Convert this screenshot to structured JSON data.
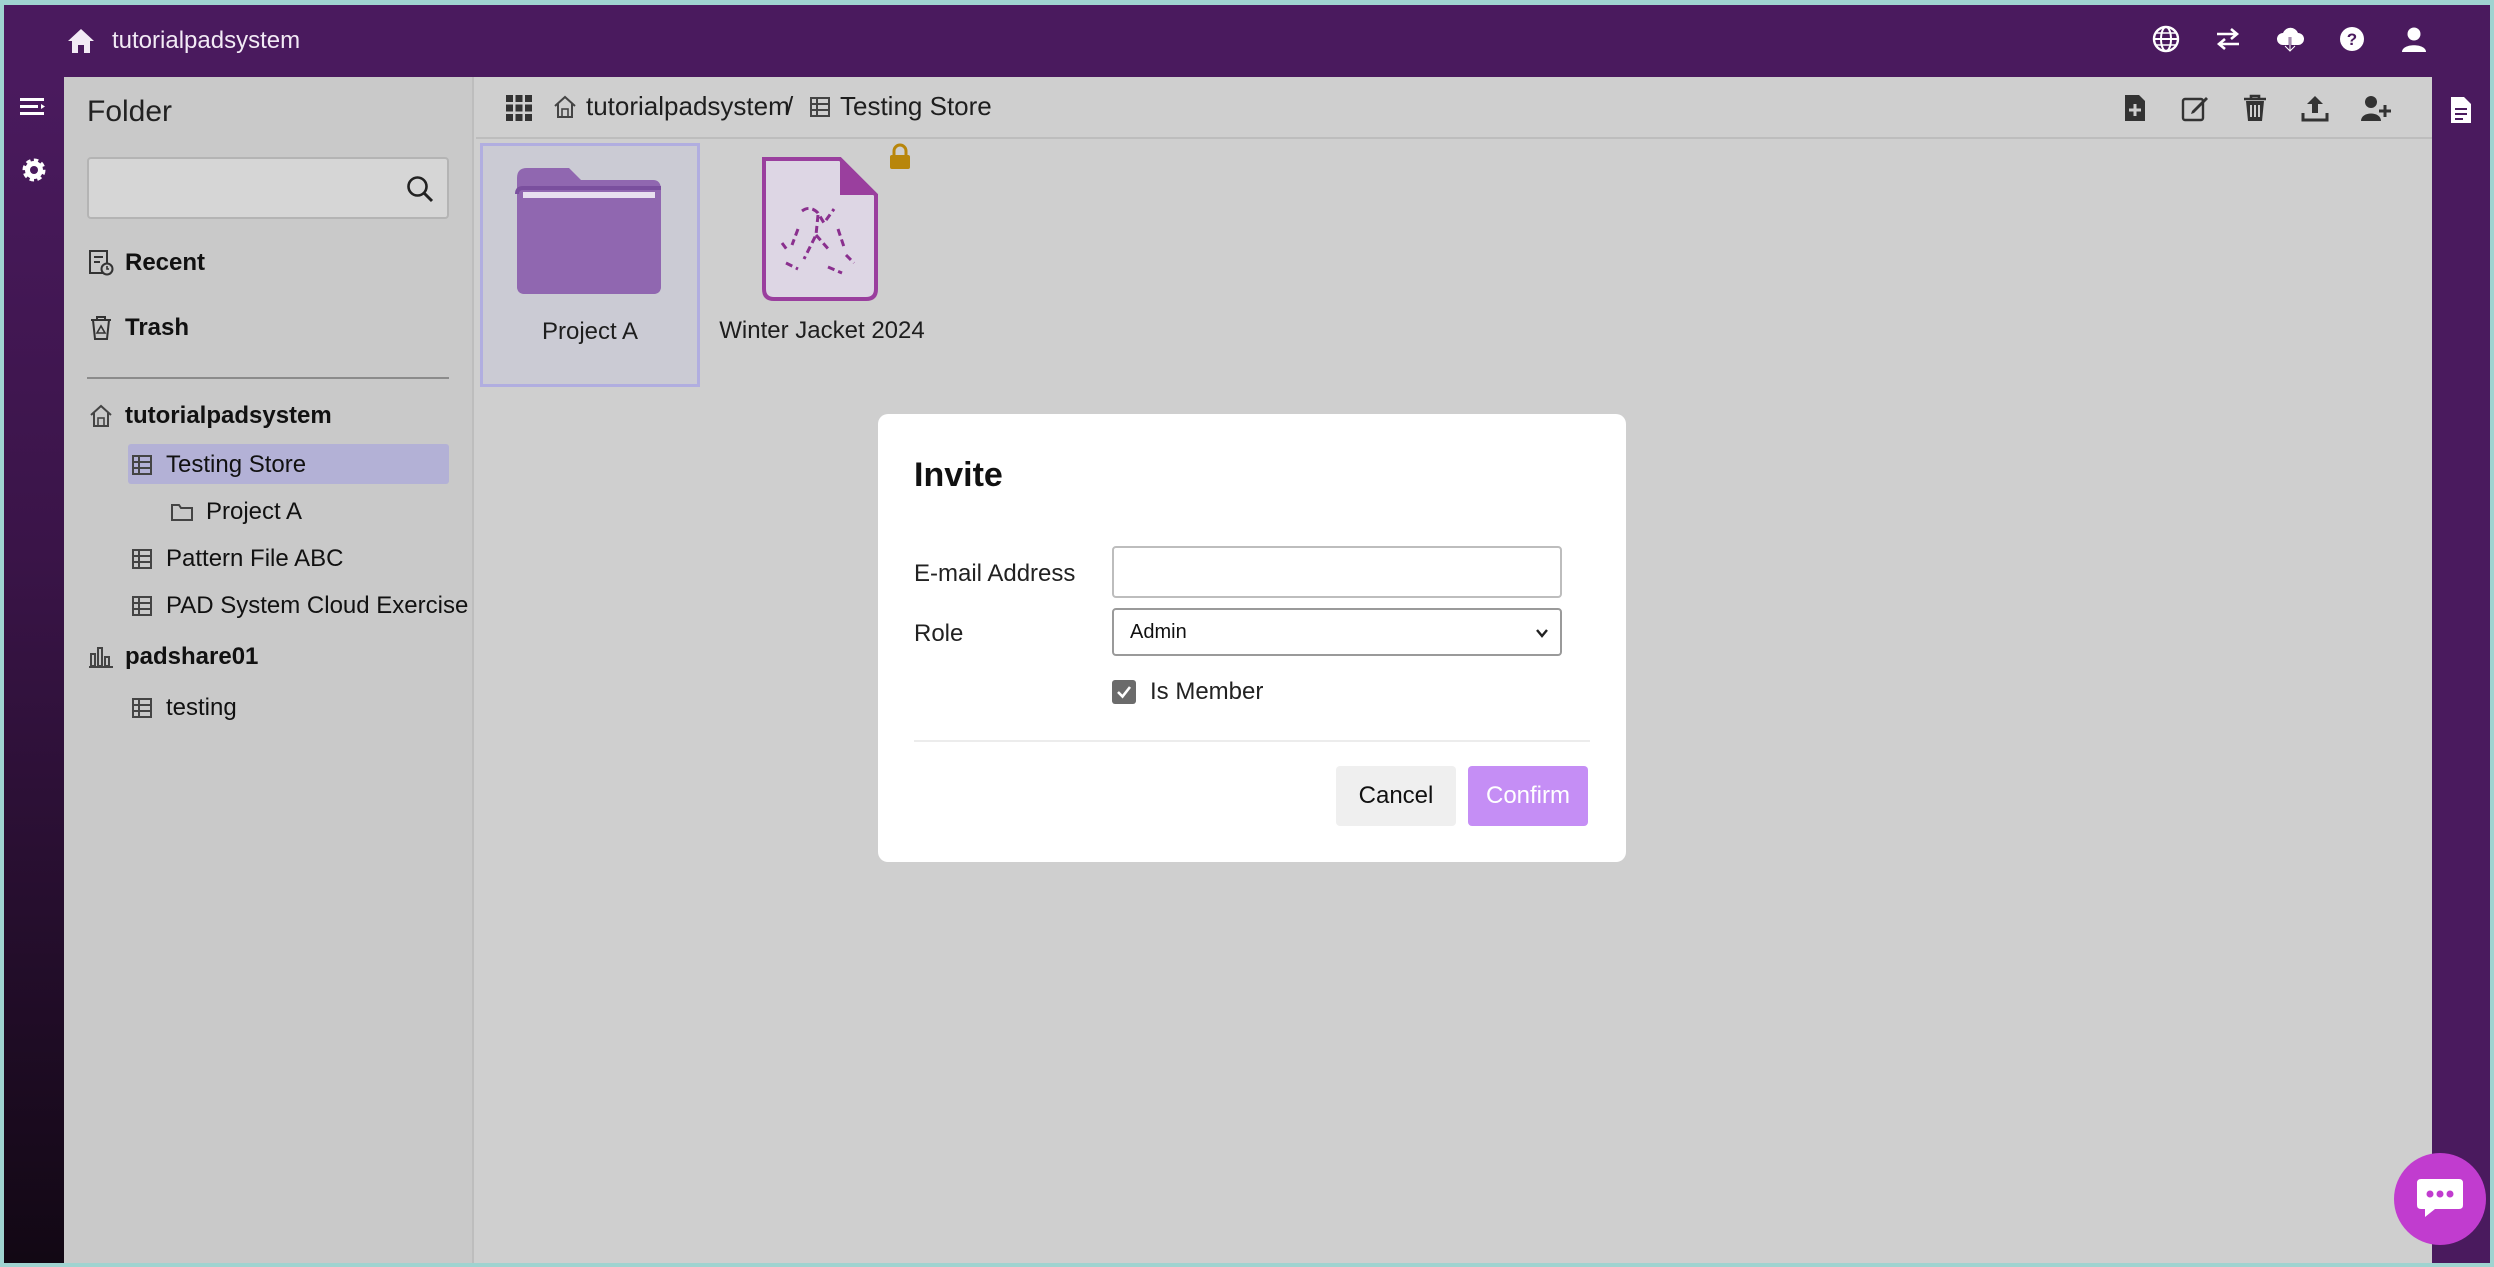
{
  "topbar": {
    "title": "tutorialpadsystem",
    "icons": [
      "globe-icon",
      "transfer-icon",
      "cloud-download-icon",
      "help-icon",
      "user-icon"
    ]
  },
  "sidebar": {
    "title": "Folder",
    "search_placeholder": "",
    "nav": [
      {
        "label": "Recent",
        "icon": "recent-icon"
      },
      {
        "label": "Trash",
        "icon": "trash-icon"
      }
    ],
    "tree": [
      {
        "label": "tutorialpadsystem",
        "icon": "home-icon",
        "level": 0
      },
      {
        "label": "Testing Store",
        "icon": "store-icon",
        "level": 1,
        "selected": true
      },
      {
        "label": "Project A",
        "icon": "folder-icon",
        "level": 2
      },
      {
        "label": "Pattern File ABC",
        "icon": "store-icon",
        "level": 1
      },
      {
        "label": "PAD System Cloud Exercise",
        "icon": "store-icon",
        "level": 1
      },
      {
        "label": "padshare01",
        "icon": "chart-icon",
        "level": 0
      },
      {
        "label": "testing",
        "icon": "store-icon",
        "level": 1
      }
    ]
  },
  "breadcrumb": {
    "root": "tutorialpadsystem",
    "separator": "/",
    "current": "Testing Store"
  },
  "toolbar": {
    "icons": [
      "new-file-icon",
      "edit-icon",
      "delete-icon",
      "upload-icon",
      "add-user-icon"
    ]
  },
  "items": [
    {
      "label": "Project A",
      "type": "folder"
    },
    {
      "label": "Winter Jacket 2024",
      "type": "pattern-file",
      "locked": true
    }
  ],
  "modal": {
    "title": "Invite",
    "email_label": "E-mail Address",
    "email_value": "",
    "role_label": "Role",
    "role_value": "Admin",
    "is_member_label": "Is Member",
    "is_member_checked": true,
    "cancel_label": "Cancel",
    "confirm_label": "Confirm"
  },
  "colors": {
    "topbar": "#4a1a5e",
    "selection": "#b3b1d6",
    "folder": "#9067b0",
    "confirm": "#c58ef5",
    "chat": "#c13ccf",
    "lock": "#b8860b"
  }
}
